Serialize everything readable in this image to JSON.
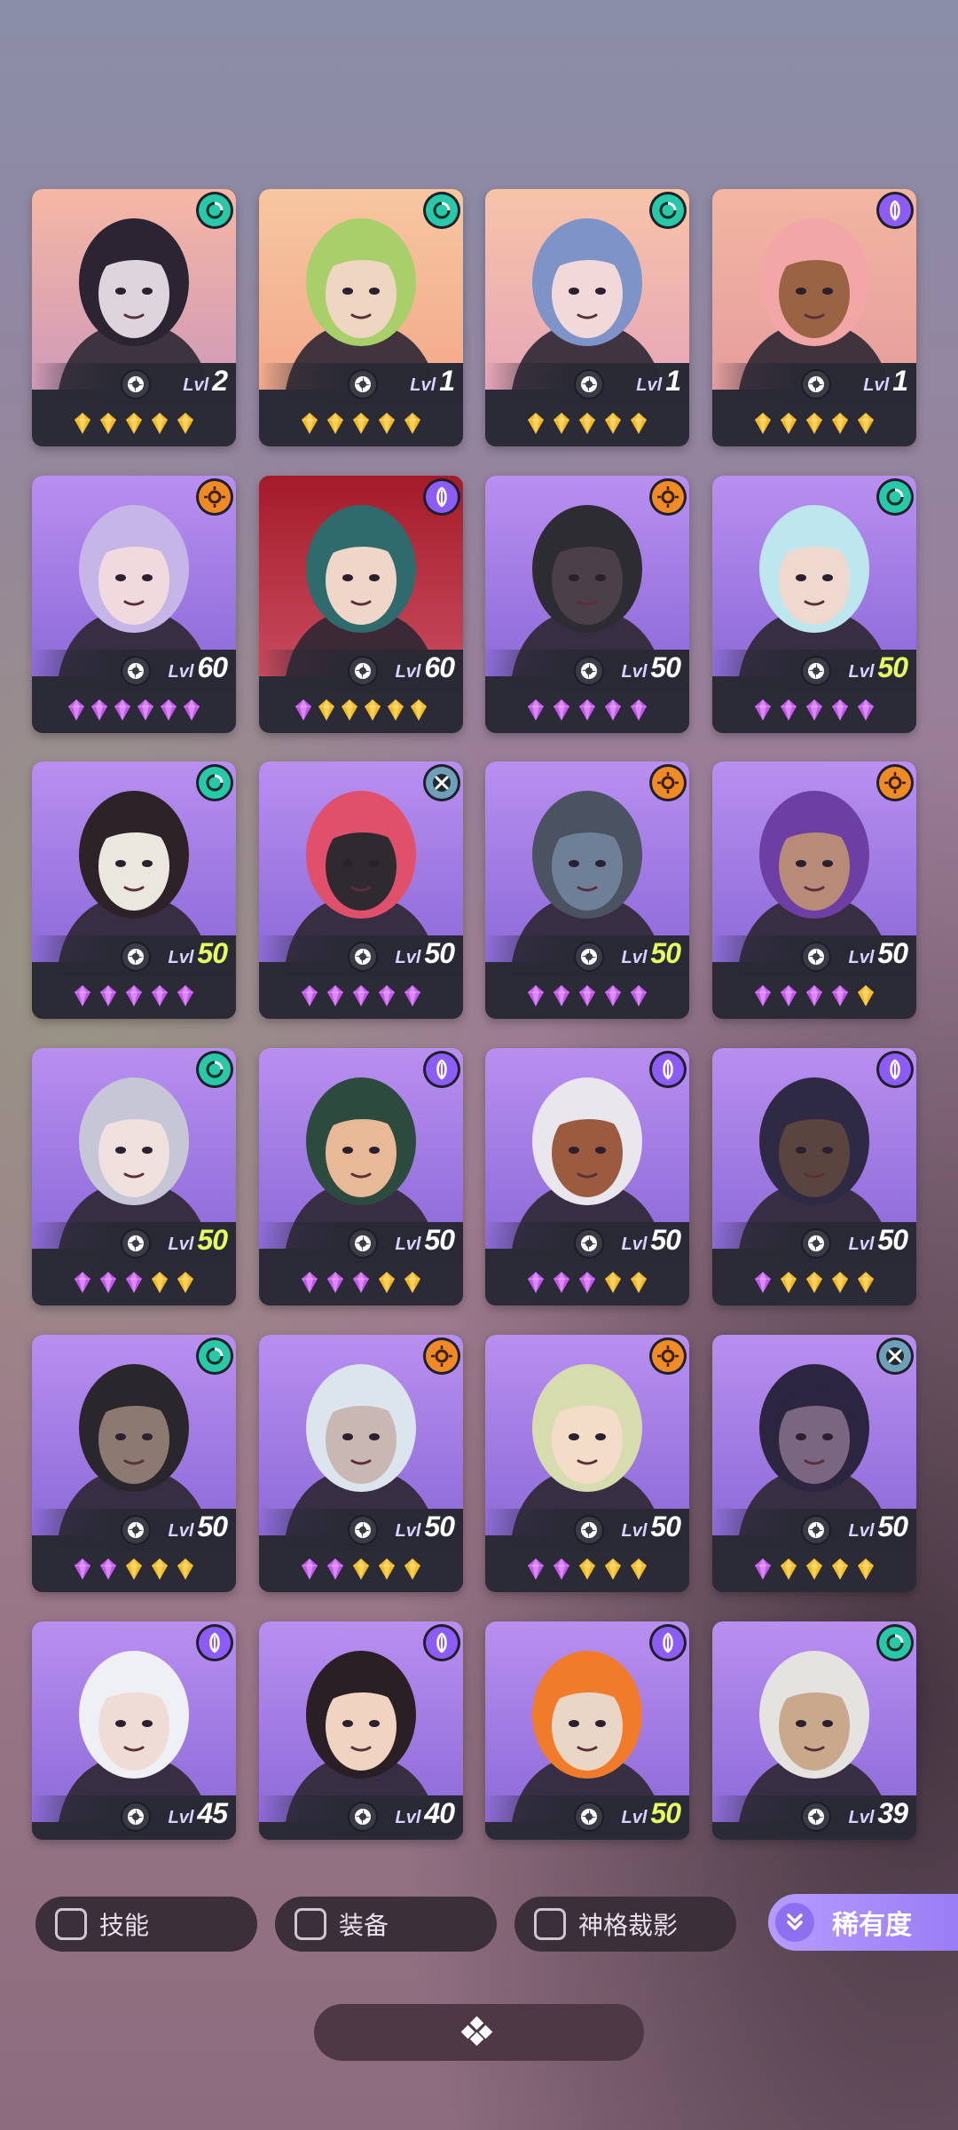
{
  "colors": {
    "element_teal": "#27c9a8",
    "element_purple": "#8b5cf6",
    "element_orange": "#f08a24",
    "element_slate": "#6fa0b8",
    "gem_gold": "#f4b821",
    "gem_purple": "#c655f0",
    "level_green": "#e4ff5e",
    "accent": "#b79bff"
  },
  "level_prefix": "Lvl",
  "heroes": [
    {
      "level": "2",
      "element": "teal",
      "gems": [
        "gold",
        "gold",
        "gold",
        "gold",
        "gold"
      ],
      "bg": [
        "#f6b7a4",
        "#cf9ab8"
      ],
      "hair": "#2b2432",
      "skin": "#ddd4dc",
      "green": false
    },
    {
      "level": "1",
      "element": "teal",
      "gems": [
        "gold",
        "gold",
        "gold",
        "gold",
        "gold"
      ],
      "bg": [
        "#f6c7a0",
        "#f3a98a"
      ],
      "hair": "#a9cf6b",
      "skin": "#efd6c3",
      "green": false
    },
    {
      "level": "1",
      "element": "teal",
      "gems": [
        "gold",
        "gold",
        "gold",
        "gold",
        "gold"
      ],
      "bg": [
        "#f7c4a8",
        "#e7a6b8"
      ],
      "hair": "#7e93c8",
      "skin": "#f2d9d9",
      "green": false
    },
    {
      "level": "1",
      "element": "purple",
      "gems": [
        "gold",
        "gold",
        "gold",
        "gold",
        "gold"
      ],
      "bg": [
        "#f2b6a1",
        "#e79d9e"
      ],
      "hair": "#f3a6a6",
      "skin": "#9a6444",
      "green": false
    },
    {
      "level": "60",
      "element": "orange",
      "gems": [
        "purple",
        "purple",
        "purple",
        "purple",
        "purple",
        "purple"
      ],
      "bg": [
        "#b98ff0",
        "#8c6ad8"
      ],
      "hair": "#c6b6e8",
      "skin": "#f0dade",
      "green": false
    },
    {
      "level": "60",
      "element": "purple",
      "gems": [
        "purple",
        "gold",
        "gold",
        "gold",
        "gold",
        "gold"
      ],
      "bg": [
        "#a41b2a",
        "#c84b5d"
      ],
      "hair": "#2f6b6c",
      "skin": "#f0d6c8",
      "green": false
    },
    {
      "level": "50",
      "element": "orange",
      "gems": [
        "purple",
        "purple",
        "purple",
        "purple",
        "purple"
      ],
      "bg": [
        "#b98ff0",
        "#8c6ad8"
      ],
      "hair": "#2e2c33",
      "skin": "#4b4048",
      "green": false
    },
    {
      "level": "50",
      "element": "teal",
      "gems": [
        "purple",
        "purple",
        "purple",
        "purple",
        "purple"
      ],
      "bg": [
        "#b98ff0",
        "#8c6ad8"
      ],
      "hair": "#bde6ef",
      "skin": "#efd9cf",
      "green": true
    },
    {
      "level": "50",
      "element": "teal",
      "gems": [
        "purple",
        "purple",
        "purple",
        "purple",
        "purple"
      ],
      "bg": [
        "#b98ff0",
        "#8c6ad8"
      ],
      "hair": "#2c2228",
      "skin": "#e9e7de",
      "green": true
    },
    {
      "level": "50",
      "element": "slate",
      "gems": [
        "purple",
        "purple",
        "purple",
        "purple",
        "purple"
      ],
      "bg": [
        "#b98ff0",
        "#8c6ad8"
      ],
      "hair": "#e0506b",
      "skin": "#2f2a30",
      "green": false
    },
    {
      "level": "50",
      "element": "orange",
      "gems": [
        "purple",
        "purple",
        "purple",
        "purple",
        "purple"
      ],
      "bg": [
        "#b98ff0",
        "#8c6ad8"
      ],
      "hair": "#4b5262",
      "skin": "#6e7f98",
      "green": true
    },
    {
      "level": "50",
      "element": "orange",
      "gems": [
        "purple",
        "purple",
        "purple",
        "purple",
        "gold"
      ],
      "bg": [
        "#b98ff0",
        "#8c6ad8"
      ],
      "hair": "#6d3ea3",
      "skin": "#b88a78",
      "green": false
    },
    {
      "level": "50",
      "element": "teal",
      "gems": [
        "purple",
        "purple",
        "purple",
        "gold",
        "gold"
      ],
      "bg": [
        "#b98ff0",
        "#8c6ad8"
      ],
      "hair": "#c7c6d6",
      "skin": "#efe1de",
      "green": true
    },
    {
      "level": "50",
      "element": "purple",
      "gems": [
        "purple",
        "purple",
        "purple",
        "gold",
        "gold"
      ],
      "bg": [
        "#b98ff0",
        "#8c6ad8"
      ],
      "hair": "#2c4a3e",
      "skin": "#e7b997",
      "green": false
    },
    {
      "level": "50",
      "element": "purple",
      "gems": [
        "purple",
        "purple",
        "purple",
        "gold",
        "gold"
      ],
      "bg": [
        "#b98ff0",
        "#8c6ad8"
      ],
      "hair": "#e9e6ee",
      "skin": "#9c5b3e",
      "green": false
    },
    {
      "level": "50",
      "element": "purple",
      "gems": [
        "purple",
        "gold",
        "gold",
        "gold",
        "gold"
      ],
      "bg": [
        "#b98ff0",
        "#8c6ad8"
      ],
      "hair": "#2f2a44",
      "skin": "#5a4440",
      "green": false
    },
    {
      "level": "50",
      "element": "teal",
      "gems": [
        "purple",
        "purple",
        "gold",
        "gold",
        "gold"
      ],
      "bg": [
        "#b98ff0",
        "#8c6ad8"
      ],
      "hair": "#2a272c",
      "skin": "#8c7a72",
      "green": false
    },
    {
      "level": "50",
      "element": "orange",
      "gems": [
        "purple",
        "purple",
        "gold",
        "gold",
        "gold"
      ],
      "bg": [
        "#b98ff0",
        "#8c6ad8"
      ],
      "hair": "#dce4ee",
      "skin": "#c9b7b4",
      "green": false
    },
    {
      "level": "50",
      "element": "orange",
      "gems": [
        "purple",
        "purple",
        "gold",
        "gold",
        "gold"
      ],
      "bg": [
        "#b98ff0",
        "#8c6ad8"
      ],
      "hair": "#d7dcaf",
      "skin": "#f3dcc8",
      "green": false
    },
    {
      "level": "50",
      "element": "slate",
      "gems": [
        "purple",
        "gold",
        "gold",
        "gold",
        "gold"
      ],
      "bg": [
        "#b98ff0",
        "#8c6ad8"
      ],
      "hair": "#2b2540",
      "skin": "#7a6680",
      "green": false
    },
    {
      "level": "45",
      "element": "purple",
      "gems": [],
      "bg": [
        "#b98ff0",
        "#8c6ad8"
      ],
      "hair": "#eef0f4",
      "skin": "#efdcd6",
      "green": false
    },
    {
      "level": "40",
      "element": "purple",
      "gems": [],
      "bg": [
        "#b98ff0",
        "#8c6ad8"
      ],
      "hair": "#2a1f24",
      "skin": "#f0d3c0",
      "green": false
    },
    {
      "level": "50",
      "element": "purple",
      "gems": [],
      "bg": [
        "#b98ff0",
        "#8c6ad8"
      ],
      "hair": "#f07b2b",
      "skin": "#e9d6c6",
      "green": true
    },
    {
      "level": "39",
      "element": "teal",
      "gems": [],
      "bg": [
        "#b98ff0",
        "#8c6ad8"
      ],
      "hair": "#e5e3e0",
      "skin": "#caa88c",
      "green": false
    }
  ],
  "filters": {
    "skills_label": "技能",
    "equipment_label": "装备",
    "divine_label": "神格裁影",
    "rarity_label": "稀有度"
  }
}
